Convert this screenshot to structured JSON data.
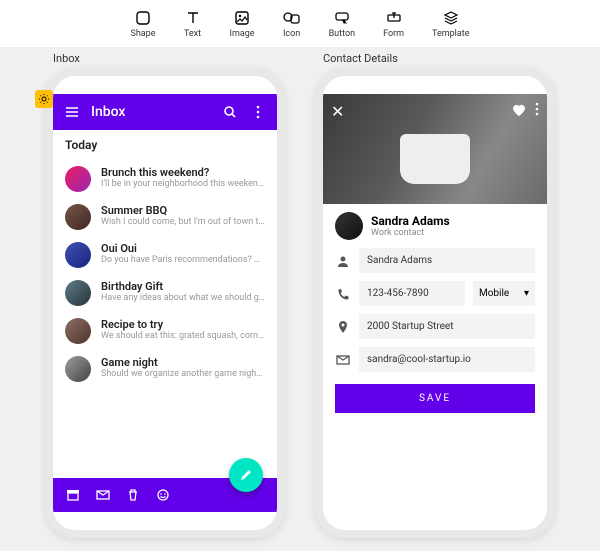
{
  "toolbar": {
    "items": [
      {
        "label": "Shape"
      },
      {
        "label": "Text"
      },
      {
        "label": "Image"
      },
      {
        "label": "Icon"
      },
      {
        "label": "Button"
      },
      {
        "label": "Form"
      },
      {
        "label": "Template"
      }
    ]
  },
  "left": {
    "label": "Inbox",
    "appbar_title": "Inbox",
    "section": "Today",
    "messages": [
      {
        "title": "Brunch this weekend?",
        "preview": "I'll be in your neighborhood this weekend..."
      },
      {
        "title": "Summer BBQ",
        "preview": "Wish I could come, but I'm out of town thi..."
      },
      {
        "title": "Oui Oui",
        "preview": "Do you have Paris recommendations? Ha..."
      },
      {
        "title": "Birthday Gift",
        "preview": "Have any ideas about what we should get..."
      },
      {
        "title": "Recipe to try",
        "preview": "We should eat this: grated squash, corn, a..."
      },
      {
        "title": "Game night",
        "preview": "Should we organize another game night l..."
      }
    ]
  },
  "right": {
    "label": "Contact Details",
    "name": "Sandra Adams",
    "subtitle": "Work contact",
    "fields": {
      "name_value": "Sandra Adams",
      "phone_value": "123-456-7890",
      "phone_type": "Mobile",
      "address_value": "2000 Startup Street",
      "email_value": "sandra@cool-startup.io"
    },
    "save_label": "SAVE"
  },
  "colors": {
    "primary": "#6200ea",
    "accent": "#00e5c4"
  }
}
